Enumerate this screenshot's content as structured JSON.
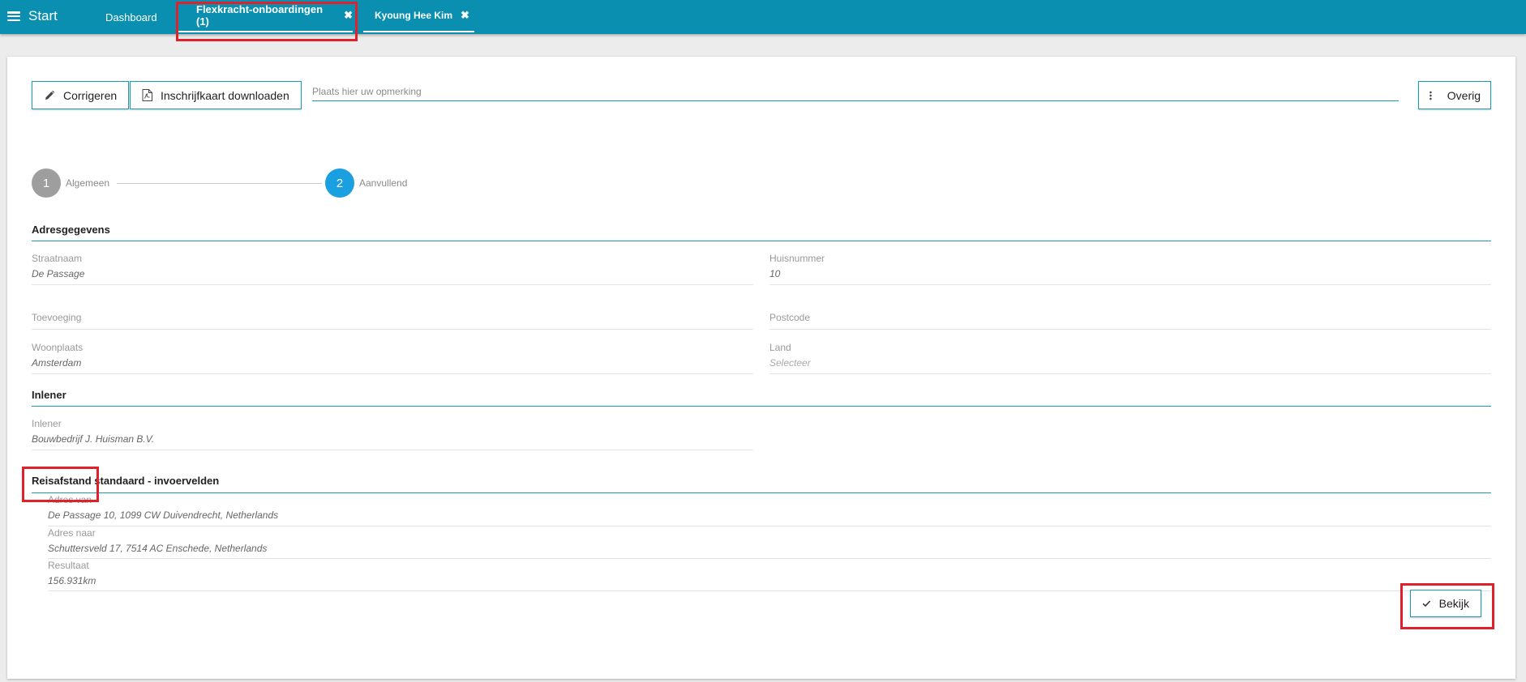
{
  "topbar": {
    "menu_label": "Start",
    "tabs": [
      {
        "label": "Dashboard"
      },
      {
        "label": "Flexkracht-onboardingen (1)",
        "close": "✖"
      },
      {
        "label": "Kyoung Hee Kim",
        "close": "✖"
      }
    ]
  },
  "toolbar": {
    "correct_label": "Corrigeren",
    "download_label": "Inschrijfkaart downloaden",
    "remark_placeholder": "Plaats hier uw opmerking",
    "more_label": "Overig"
  },
  "stepper": {
    "steps": [
      {
        "number": "1",
        "label": "Algemeen",
        "state": "inactive"
      },
      {
        "number": "2",
        "label": "Aanvullend",
        "state": "active"
      }
    ]
  },
  "sections": {
    "address": {
      "title": "Adresgegevens",
      "fields": {
        "street": {
          "label": "Straatnaam",
          "value": "De Passage"
        },
        "housenumber": {
          "label": "Huisnummer",
          "value": "10"
        },
        "addition": {
          "label": "Toevoeging",
          "value": ""
        },
        "postcode": {
          "label": "Postcode",
          "value": ""
        },
        "city": {
          "label": "Woonplaats",
          "value": "Amsterdam"
        },
        "country": {
          "label": "Land",
          "value": "Selecteer"
        }
      }
    },
    "hirer": {
      "title": "Inlener",
      "fields": {
        "hirer": {
          "label": "Inlener",
          "value": "Bouwbedrijf J. Huisman B.V."
        }
      }
    },
    "travel": {
      "title": "Reisafstand standaard - invoervelden",
      "fields": {
        "from": {
          "label": "Adres van",
          "value": "De Passage 10, 1099 CW Duivendrecht, Netherlands"
        },
        "to": {
          "label": "Adres naar",
          "value": "Schuttersveld 17, 7514 AC Enschede, Netherlands"
        },
        "result": {
          "label": "Resultaat",
          "value": "156.931km"
        }
      },
      "view_label": "Bekijk"
    }
  },
  "colors": {
    "topbar": "#0a8fb0",
    "accent": "#1a9bb0",
    "step_active": "#1a9fe0",
    "step_inactive": "#9e9e9e",
    "highlight": "#e0202a"
  }
}
